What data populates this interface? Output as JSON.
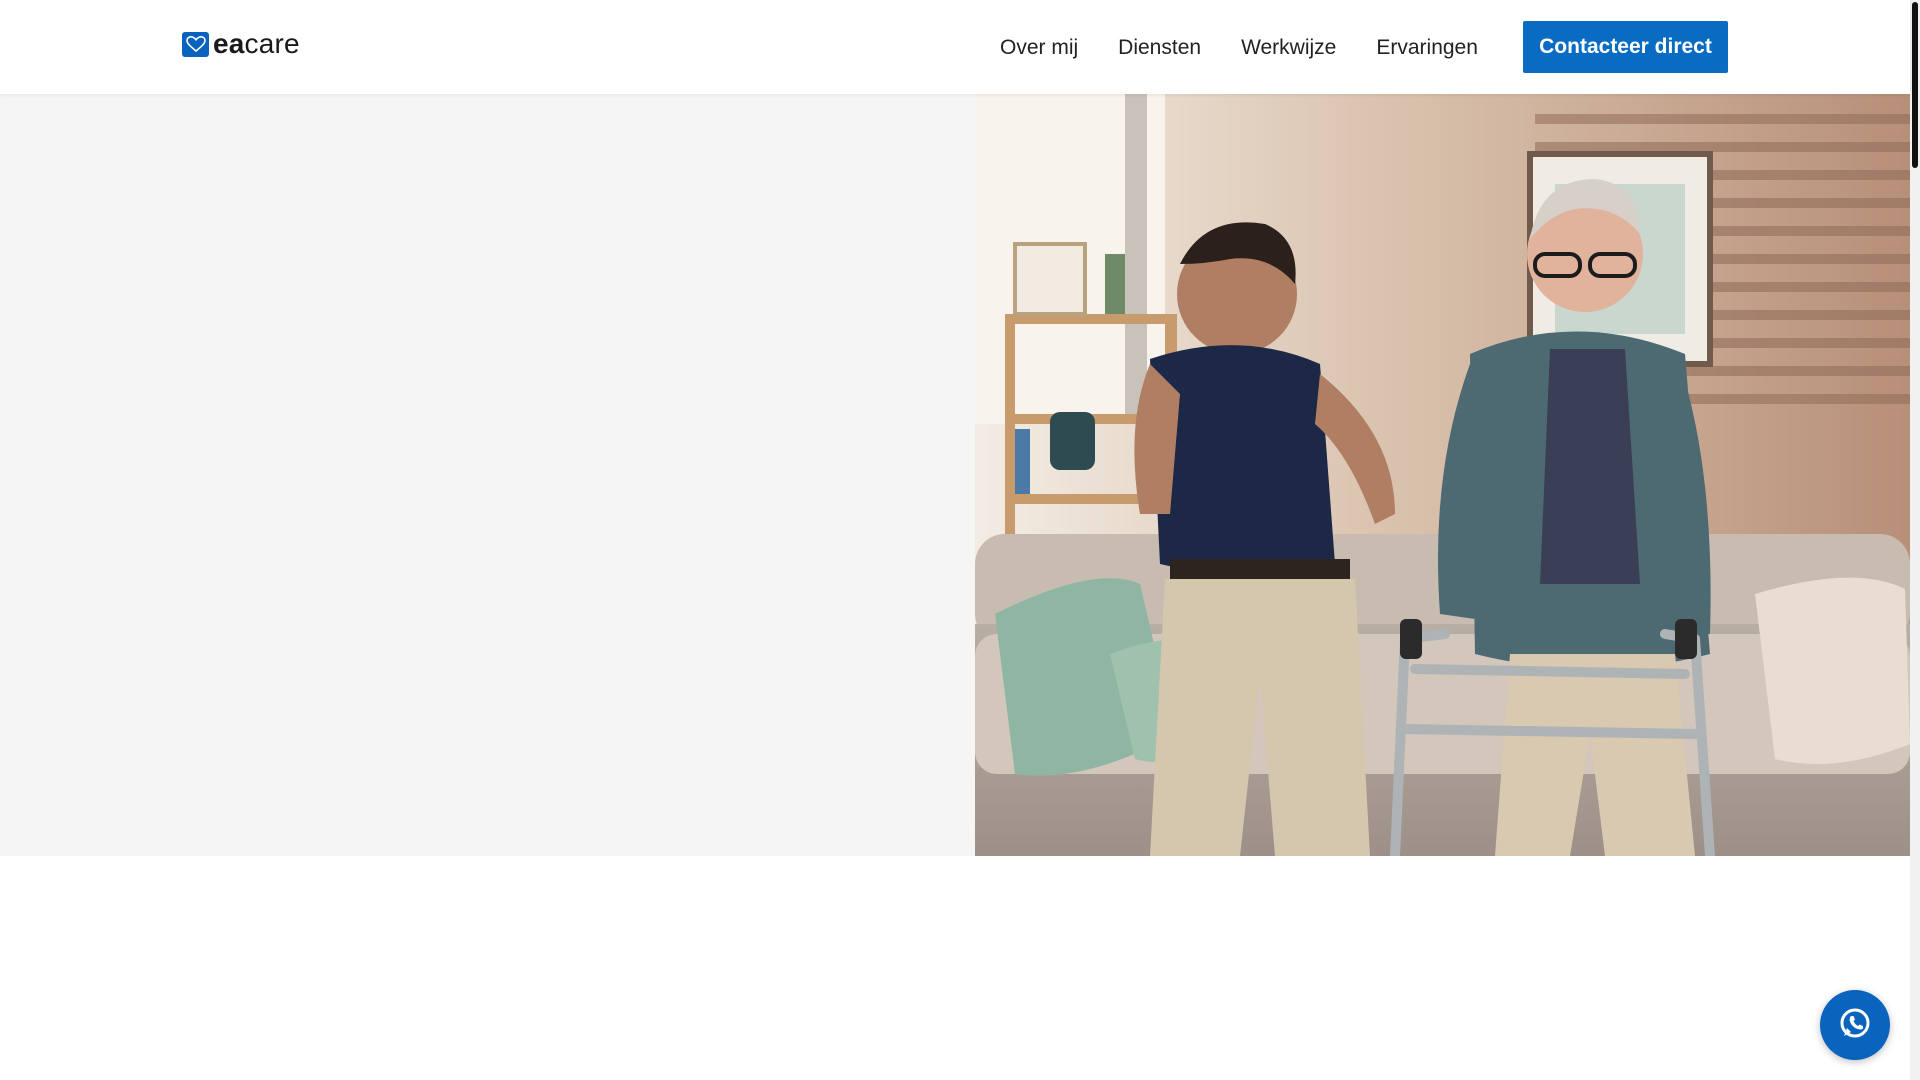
{
  "brand": {
    "logo_text_bold": "ea",
    "logo_text_light": "care",
    "logo_icon": "heart-icon"
  },
  "nav": {
    "items": [
      {
        "label": "Over mij"
      },
      {
        "label": "Diensten"
      },
      {
        "label": "Werkwijze"
      },
      {
        "label": "Ervaringen"
      }
    ],
    "cta_label": "Contacteer direct"
  },
  "hero": {
    "image_icon": "hero-photo"
  },
  "floating": {
    "whatsapp_icon": "whatsapp-icon"
  },
  "colors": {
    "accent": "#0a6bc2",
    "hero_left_bg": "#f5f5f5",
    "text": "#222222"
  }
}
